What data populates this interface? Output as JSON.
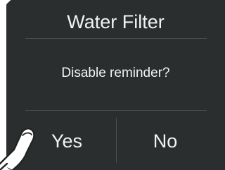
{
  "dialog": {
    "title": "Water Filter",
    "message": "Disable reminder?",
    "yes_label": "Yes",
    "no_label": "No"
  },
  "colors": {
    "background": "#2b2e2f",
    "text": "#f2f2f2",
    "divider": "#4a4e50"
  },
  "icons": {
    "pointer": "pointing-hand-icon"
  }
}
